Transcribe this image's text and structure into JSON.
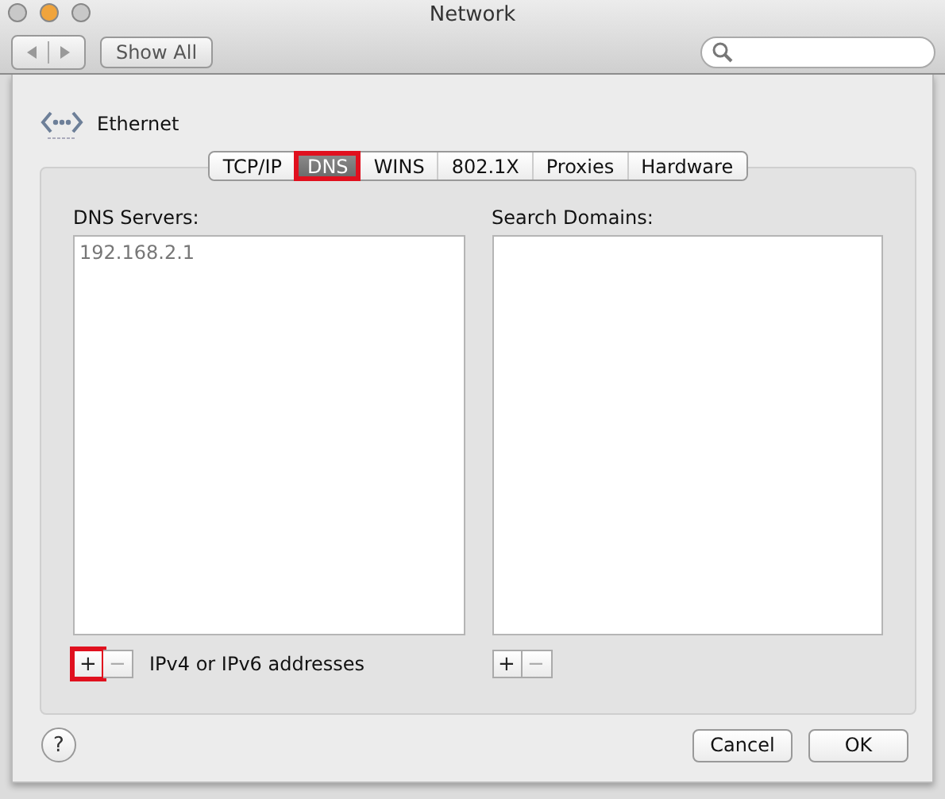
{
  "window": {
    "title": "Network"
  },
  "toolbar": {
    "show_all": "Show All"
  },
  "service": {
    "name": "Ethernet"
  },
  "tabs": [
    {
      "label": "TCP/IP",
      "selected": false,
      "highlighted": false
    },
    {
      "label": "DNS",
      "selected": true,
      "highlighted": true
    },
    {
      "label": "WINS",
      "selected": false,
      "highlighted": false
    },
    {
      "label": "802.1X",
      "selected": false,
      "highlighted": false
    },
    {
      "label": "Proxies",
      "selected": false,
      "highlighted": false
    },
    {
      "label": "Hardware",
      "selected": false,
      "highlighted": false
    }
  ],
  "dns_servers": {
    "label": "DNS Servers:",
    "items": [
      "192.168.2.1"
    ],
    "add": {
      "label": "+",
      "highlighted": true
    },
    "remove": {
      "label": "−"
    },
    "hint": "IPv4 or IPv6 addresses"
  },
  "search_domains": {
    "label": "Search Domains:",
    "add": {
      "label": "+",
      "highlighted": false
    },
    "remove": {
      "label": "−"
    }
  },
  "footer": {
    "help": "?",
    "buttons": [
      "Cancel",
      "OK"
    ]
  }
}
